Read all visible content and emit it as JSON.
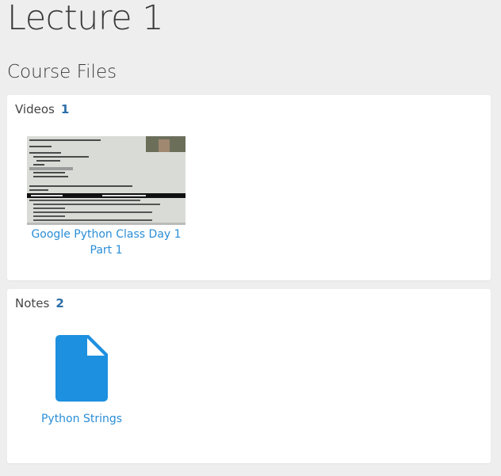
{
  "page": {
    "title": "Lecture 1"
  },
  "course_files": {
    "title": "Course Files",
    "videos": {
      "label": "Videos",
      "count": "1",
      "items": [
        {
          "title": "Google Python Class Day 1 Part 1",
          "icon": "video-thumbnail"
        }
      ]
    },
    "notes": {
      "label": "Notes",
      "count": "2",
      "items": [
        {
          "title": "Python Strings",
          "icon": "document-icon"
        }
      ]
    }
  },
  "colors": {
    "background": "#eeeeee",
    "card": "#ffffff",
    "link": "#2a8ed6",
    "count": "#2c6ea8",
    "doc_icon": "#1e90e0"
  }
}
